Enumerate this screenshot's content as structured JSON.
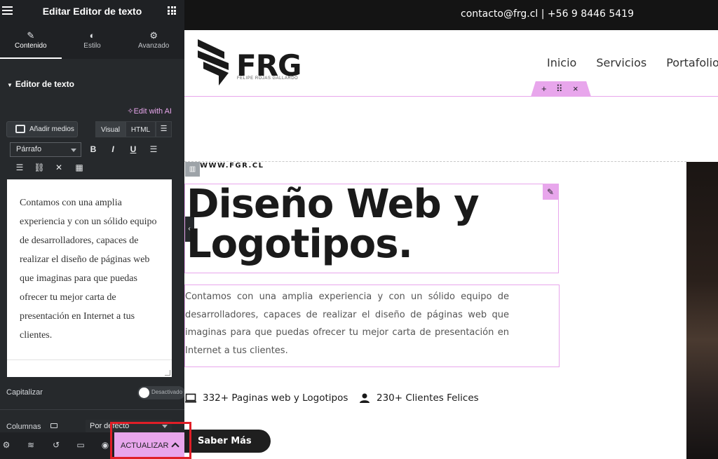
{
  "panel": {
    "title": "Editar Editor de texto",
    "tabs": [
      {
        "label": "Contenido",
        "icon": "pencil-icon"
      },
      {
        "label": "Estilo",
        "icon": "half-circle-icon"
      },
      {
        "label": "Avanzado",
        "icon": "gear-icon"
      }
    ],
    "section_title": "Editor de texto",
    "ai_link": "Edit with AI",
    "media_button": "Añadir medios",
    "visual_tab": "Visual",
    "html_tab": "HTML",
    "format_select": "Párrafo",
    "toolbar_buttons": {
      "bold": "B",
      "italic": "I",
      "underline": "U"
    },
    "editor_text": "Contamos con una amplia experiencia y con un sólido equipo de desarrolladores, capaces de realizar el diseño de páginas web que imaginas para que puedas ofrecer tu mejor carta de presentación en Internet a tus clientes.",
    "capitalize_label": "Capitalizar",
    "capitalize_toggle": "Desactivado",
    "columns_label": "Columnas",
    "columns_value": "Por defecto",
    "update_button": "ACTUALIZAR"
  },
  "preview": {
    "topbar_contact": "contacto@frg.cl | +56 9 8446 5419",
    "logo_text": "FRG",
    "logo_sub": "FELIPE ROJAS GALLARDO",
    "nav": [
      "Inicio",
      "Servicios",
      "Portafolio"
    ],
    "handle": {
      "add": "+",
      "move": "⠿",
      "close": "×"
    },
    "site_url": "WWW.FGR.CL",
    "heading_line1": "Diseño Web y",
    "heading_line2": "Logotipos.",
    "paragraph": "Contamos con una amplia experiencia y con un sólido equipo de desarrolladores, capaces de realizar el diseño de páginas web que imaginas para que puedas ofrecer tu mejor carta de presentación en Internet a tus clientes.",
    "stats": [
      {
        "label": "332+ Paginas web y Logotipos",
        "icon": "laptop-icon"
      },
      {
        "label": "230+ Clientes Felices",
        "icon": "user-icon"
      }
    ],
    "cta_button": "Saber Más"
  },
  "colors": {
    "panel_bg": "#26292c",
    "accent_pink": "#e8a6ec",
    "highlight_red": "#e01e27",
    "topbar_bg": "#141414"
  }
}
